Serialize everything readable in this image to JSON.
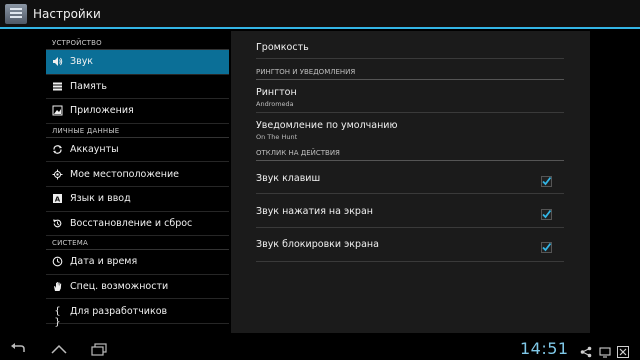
{
  "app": {
    "title": "Настройки"
  },
  "left": {
    "sections": [
      {
        "label": "УСТРОЙСТВО",
        "items": [
          {
            "label": "Звук",
            "icon": "volume-icon",
            "active": true
          },
          {
            "label": "Память",
            "icon": "storage-icon"
          },
          {
            "label": "Приложения",
            "icon": "apps-icon"
          }
        ]
      },
      {
        "label": "ЛИЧНЫЕ ДАННЫЕ",
        "items": [
          {
            "label": "Аккаунты",
            "icon": "sync-icon"
          },
          {
            "label": "Мое местоположение",
            "icon": "location-icon"
          },
          {
            "label": "Язык и ввод",
            "icon": "language-icon"
          },
          {
            "label": "Восстановление и сброс",
            "icon": "backup-icon"
          }
        ]
      },
      {
        "label": "СИСТЕМА",
        "items": [
          {
            "label": "Дата и время",
            "icon": "clock-icon"
          },
          {
            "label": "Спец. возможности",
            "icon": "hand-icon"
          },
          {
            "label": "Для разработчиков",
            "icon": "braces-icon"
          }
        ]
      }
    ]
  },
  "right": {
    "volume": {
      "title": "Громкость"
    },
    "cat_ringtone": "РИНГТОН И УВЕДОМЛЕНИЯ",
    "ringtone": {
      "title": "Рингтон",
      "subtitle": "Andromeda"
    },
    "notification": {
      "title": "Уведомление по умолчанию",
      "subtitle": "On The Hunt"
    },
    "cat_feedback": "ОТКЛИК НА ДЕЙСТВИЯ",
    "key_sounds": {
      "title": "Звук клавиш",
      "checked": true
    },
    "touch_sounds": {
      "title": "Звук нажатия на экран",
      "checked": true
    },
    "lock_sounds": {
      "title": "Звук блокировки экрана",
      "checked": true
    }
  },
  "statusbar": {
    "clock": "14:51"
  },
  "colors": {
    "accent": "#33b5e5",
    "active_item": "#0b6f97",
    "clock": "#7fc8e8"
  }
}
